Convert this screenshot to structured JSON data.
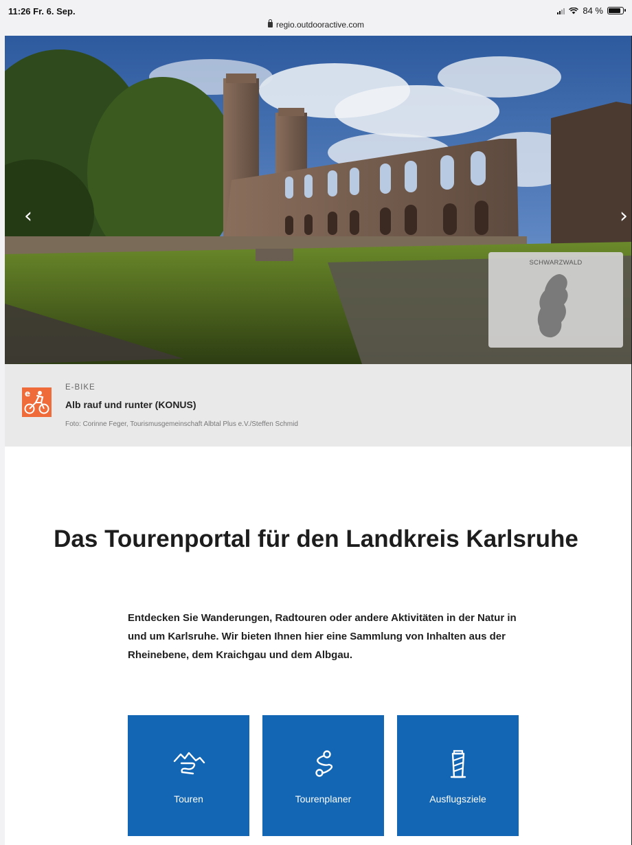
{
  "status_bar": {
    "time_date": "11:26  Fr. 6. Sep.",
    "battery": "84 %",
    "battery_level": 0.84,
    "url": "regio.outdooractive.com"
  },
  "hero": {
    "prev_icon": "chevron-left-icon",
    "next_icon": "chevron-right-icon",
    "region_label": "SCHWARZWALD"
  },
  "caption": {
    "category": "E-BIKE",
    "title": "Alb rauf und runter (KONUS)",
    "credit": "Foto: Corinne Feger, Tourismusgemeinschaft Albtal Plus e.V./Steffen Schmid",
    "icon": "ebike-icon",
    "icon_color": "#ef6c3a"
  },
  "main": {
    "headline": "Das Tourenportal für den Landkreis Karlsruhe",
    "intro": "Entdecken Sie Wanderungen, Radtouren oder andere Aktivitäten in der Natur in und um Karlsruhe. Wir bieten Ihnen hier eine Sammlung von Inhalten aus der Rheinebene, dem Kraichgau und dem Albgau."
  },
  "tiles": [
    {
      "label": "Touren",
      "icon": "mountain-route-icon"
    },
    {
      "label": "Tourenplaner",
      "icon": "route-planner-icon"
    },
    {
      "label": "Ausflugsziele",
      "icon": "tower-icon"
    }
  ],
  "colors": {
    "tile_blue": "#1366b4",
    "caption_bg": "#e9e9ea"
  }
}
